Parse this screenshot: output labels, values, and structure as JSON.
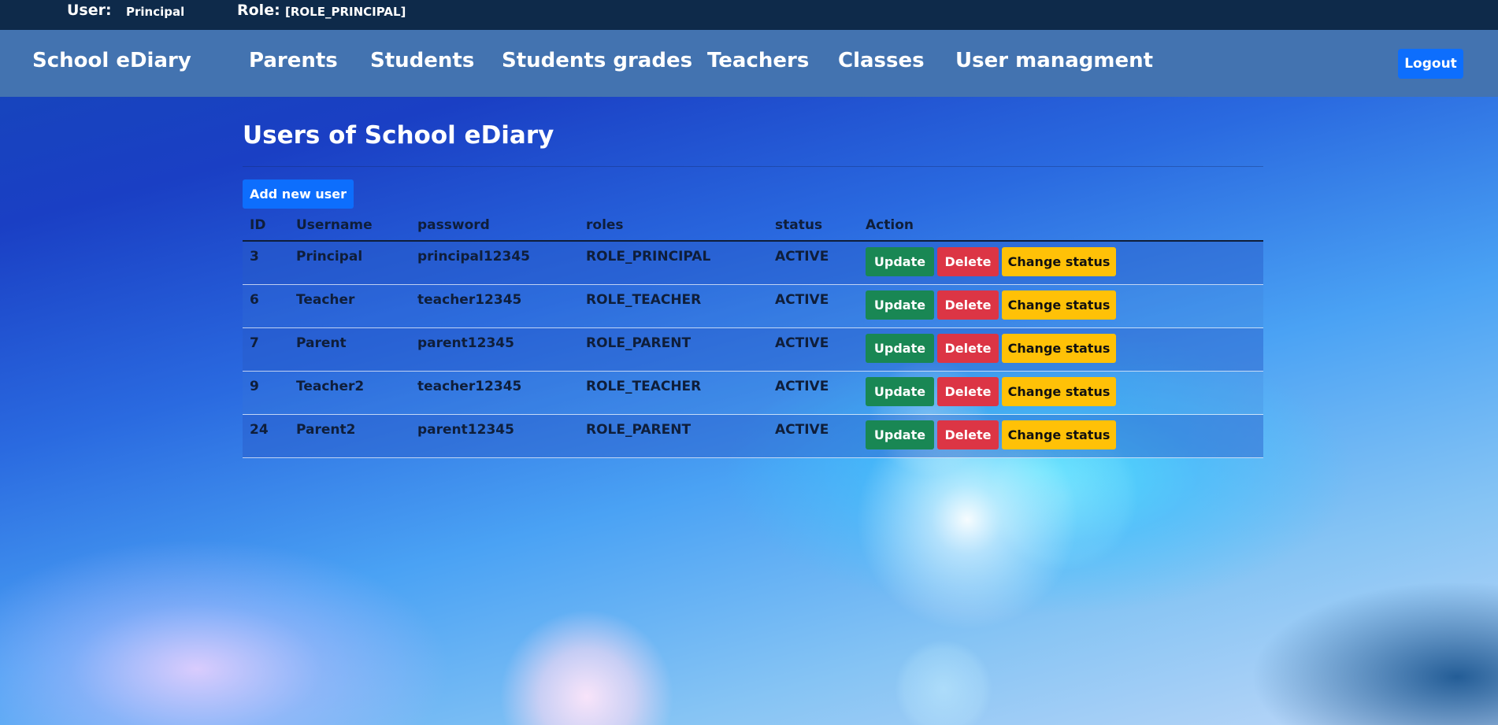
{
  "topbar": {
    "user_label": "User:",
    "user_value": "Principal",
    "role_label": "Role:",
    "role_value": "[ROLE_PRINCIPAL]"
  },
  "navbar": {
    "brand": "School eDiary",
    "links": [
      "Parents",
      "Students",
      "Students grades",
      "Teachers",
      "Classes",
      "User managment"
    ],
    "logout": "Logout"
  },
  "main": {
    "title": "Users of School eDiary",
    "add_button": "Add new user",
    "columns": [
      "ID",
      "Username",
      "password",
      "roles",
      "status",
      "Action"
    ],
    "actions": {
      "update": "Update",
      "delete": "Delete",
      "change_status": "Change status"
    },
    "rows": [
      {
        "id": "3",
        "username": "Principal",
        "password": "principal12345",
        "role": "ROLE_PRINCIPAL",
        "status": "ACTIVE"
      },
      {
        "id": "6",
        "username": "Teacher",
        "password": "teacher12345",
        "role": "ROLE_TEACHER",
        "status": "ACTIVE"
      },
      {
        "id": "7",
        "username": "Parent",
        "password": "parent12345",
        "role": "ROLE_PARENT",
        "status": "ACTIVE"
      },
      {
        "id": "9",
        "username": "Teacher2",
        "password": "teacher12345",
        "role": "ROLE_TEACHER",
        "status": "ACTIVE"
      },
      {
        "id": "24",
        "username": "Parent2",
        "password": "parent12345",
        "role": "ROLE_PARENT",
        "status": "ACTIVE"
      }
    ]
  },
  "colors": {
    "topbar": "#0e2a4a",
    "navbar": "#4373b0",
    "primary": "#0d6efd",
    "success": "#198754",
    "danger": "#dc3545",
    "warning": "#ffc107"
  }
}
